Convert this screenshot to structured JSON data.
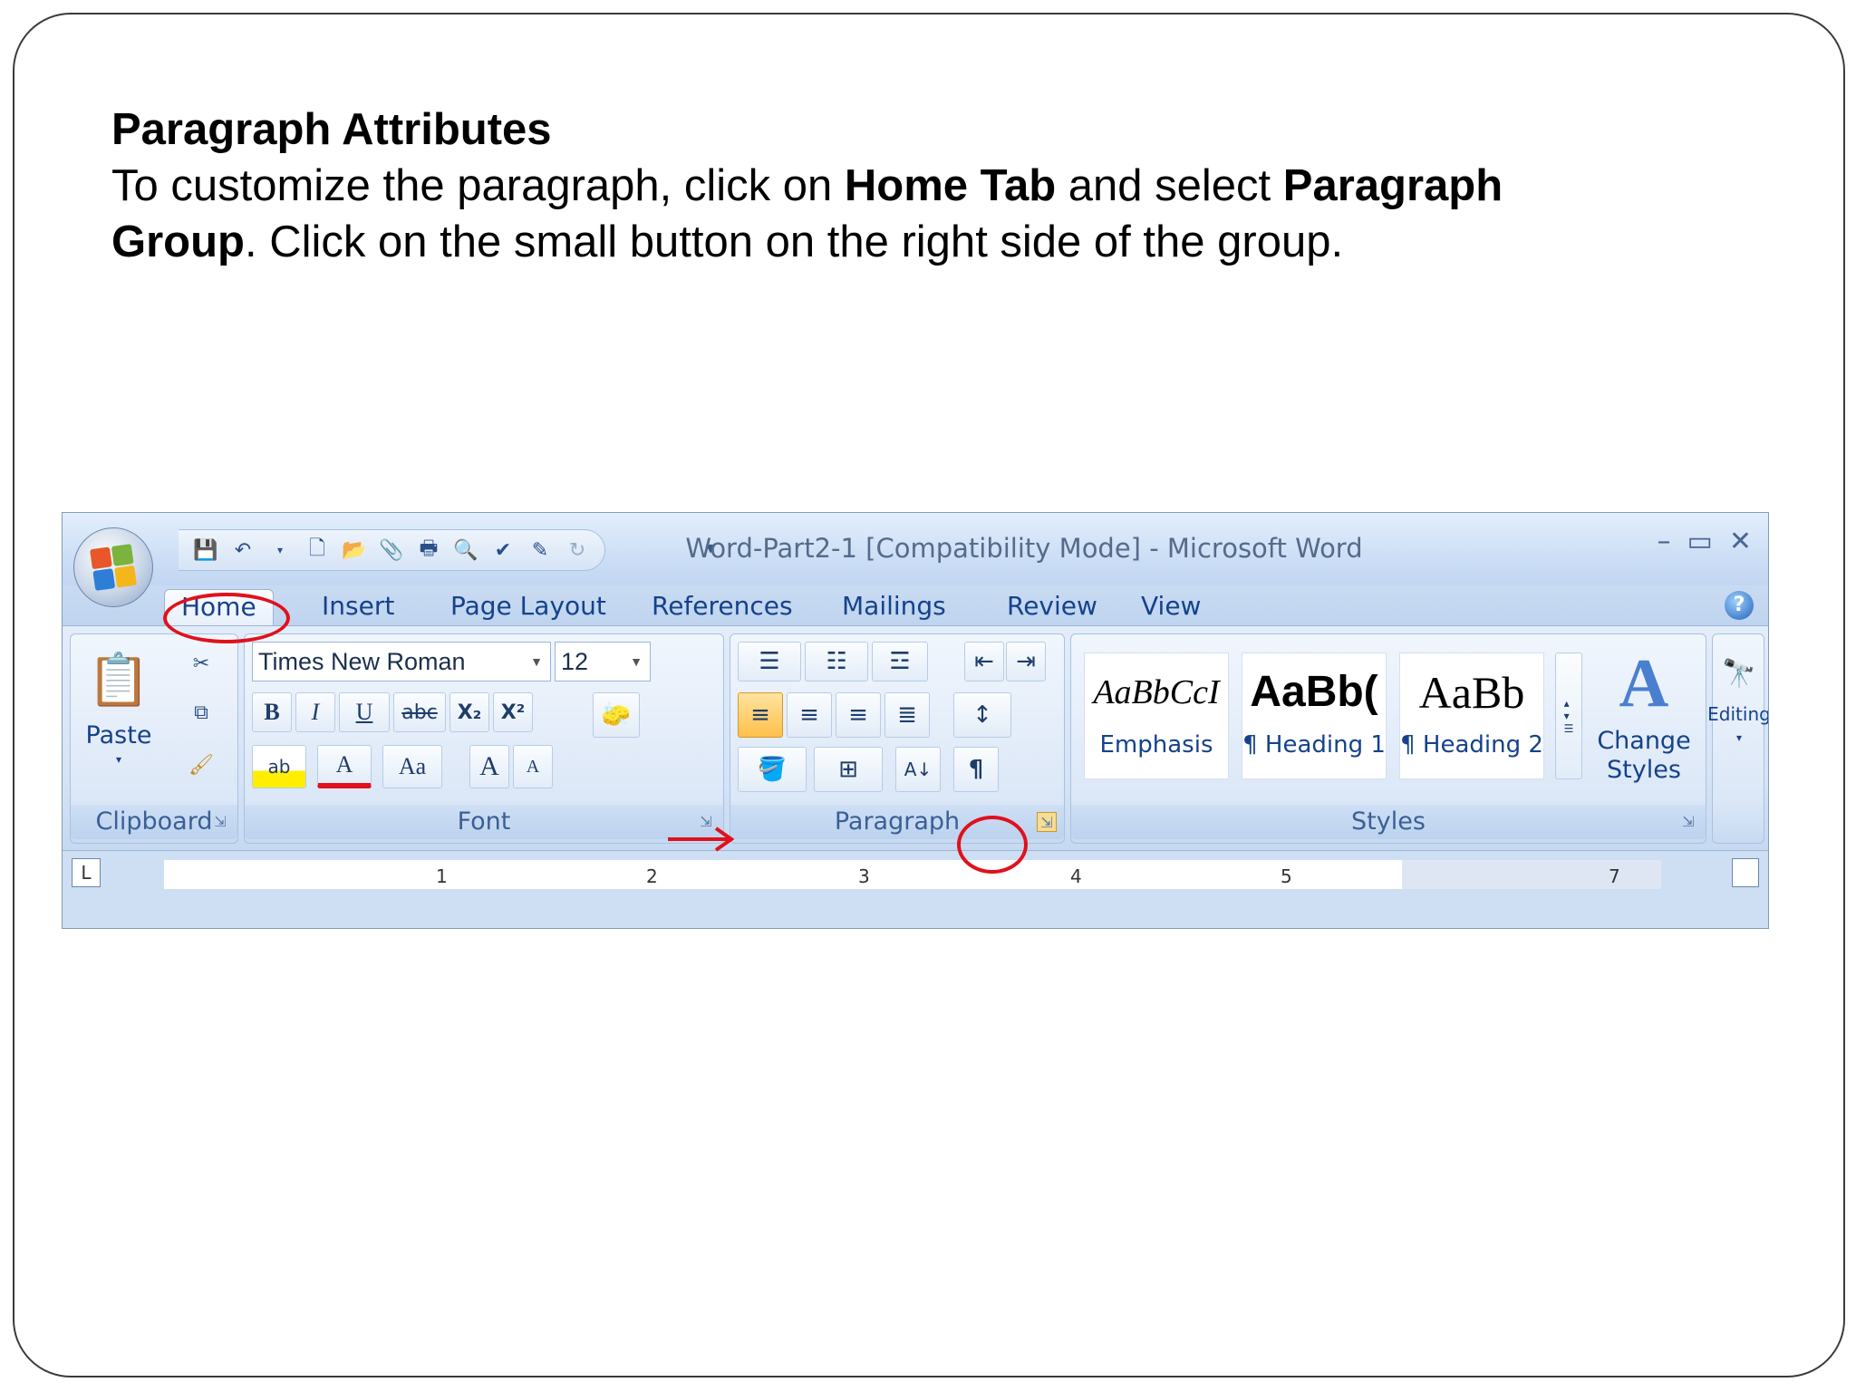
{
  "slide": {
    "heading": "Paragraph Attributes",
    "line1_a": "To customize the paragraph, click on ",
    "line1_b": "Home Tab",
    "line1_c": " and select ",
    "line1_d": "Paragraph",
    "line2_a": "Group",
    "line2_b": ". Click on the small button on the right side of the group."
  },
  "window": {
    "title": "Word-Part2-1 [Compatibility Mode] - Microsoft Word",
    "controls": [
      "–",
      "▭",
      "✕"
    ],
    "qat_icons": [
      "save-icon",
      "undo-icon",
      "undo-dropdown-icon",
      "new-document-icon",
      "open-folder-icon",
      "attach-icon",
      "print-icon",
      "print-preview-icon",
      "spelling-icon",
      "edit-icon",
      "redo-icon"
    ]
  },
  "tabs": [
    "Home",
    "Insert",
    "Page Layout",
    "References",
    "Mailings",
    "Review",
    "View"
  ],
  "ribbon": {
    "clipboard": {
      "label": "Clipboard",
      "paste": "Paste"
    },
    "font": {
      "label": "Font",
      "font_name": "Times New Roman",
      "font_size": "12",
      "bold": "B",
      "italic": "I",
      "underline": "U",
      "strike": "abc",
      "subscript": "X₂",
      "superscript": "X²",
      "change_case": "Aa",
      "grow": "A",
      "shrink": "A"
    },
    "paragraph": {
      "label": "Paragraph"
    },
    "styles": {
      "label": "Styles",
      "items": [
        {
          "preview": "AaBbCcI",
          "name": "Emphasis"
        },
        {
          "preview": "AaBb(",
          "name": "¶ Heading 1"
        },
        {
          "preview": "AaBb",
          "name": "¶ Heading 2"
        }
      ],
      "change_styles_1": "Change",
      "change_styles_2": "Styles"
    },
    "editing": {
      "label": "Editing"
    }
  },
  "ruler": {
    "numbers": [
      "1",
      "2",
      "3",
      "4",
      "5",
      "7"
    ]
  },
  "colors": {
    "highlight_red": "#e0111b",
    "ribbon_blue": "#15428b"
  }
}
